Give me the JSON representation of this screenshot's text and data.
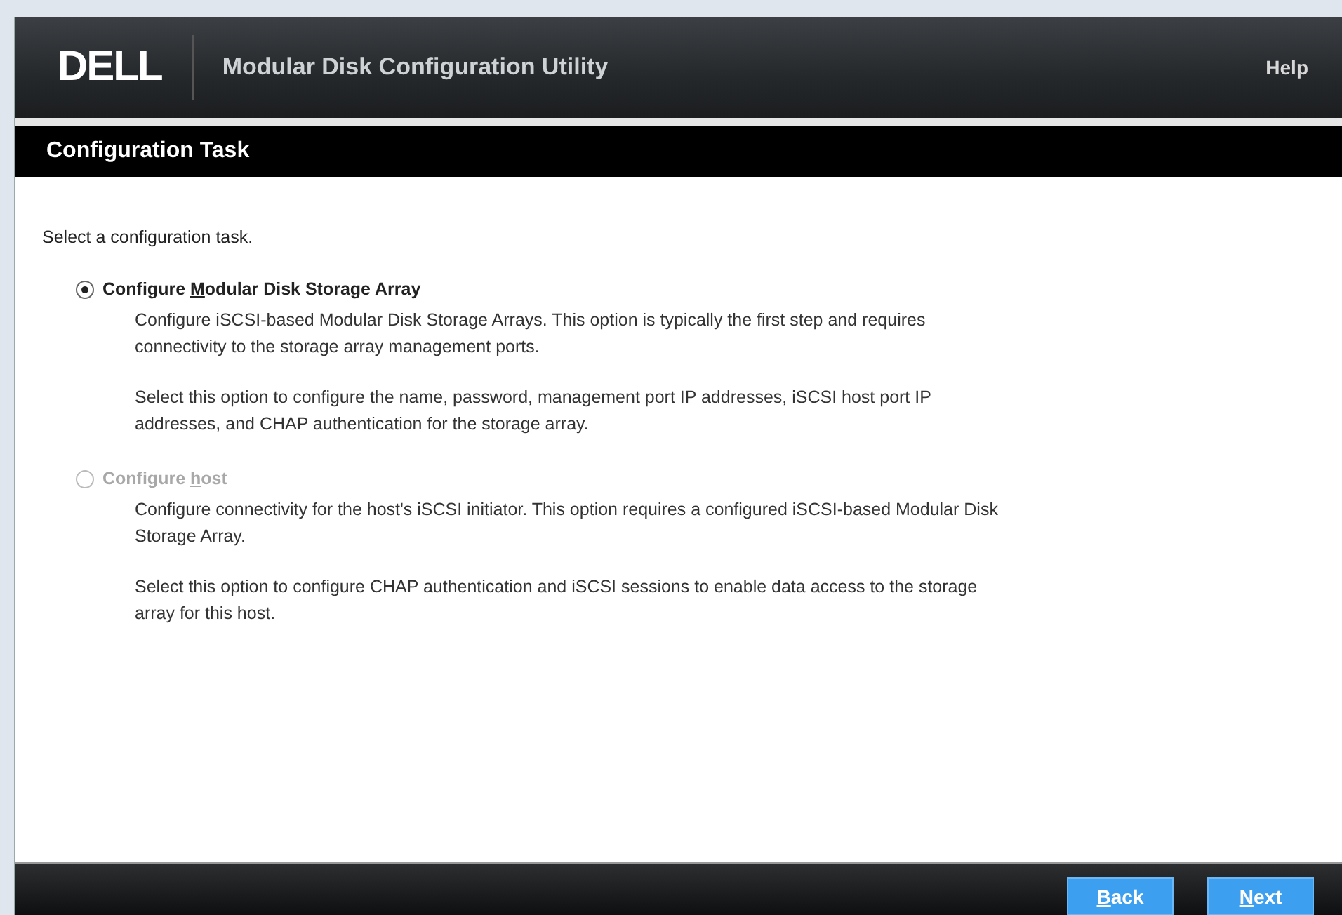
{
  "header": {
    "logo": "DELL",
    "title": "Modular Disk Configuration Utility",
    "help": "Help"
  },
  "section_title": "Configuration Task",
  "prompt": "Select a configuration task.",
  "options": [
    {
      "label_parts": [
        "Configure ",
        "M",
        "odular Disk Storage Array"
      ],
      "selected": true,
      "disabled": false,
      "paragraphs": [
        "Configure iSCSI-based Modular Disk Storage Arrays. This option is typically the first step and requires connectivity to the storage array management ports.",
        "Select this option to configure the name, password, management port IP addresses, iSCSI host port IP addresses, and CHAP authentication for the storage array."
      ]
    },
    {
      "label_parts": [
        "Configure ",
        "h",
        "ost"
      ],
      "selected": false,
      "disabled": true,
      "paragraphs": [
        "Configure connectivity for the host's iSCSI initiator. This option requires a configured iSCSI-based Modular Disk Storage Array.",
        "Select this option to configure CHAP authentication and iSCSI sessions to enable data access to the storage array for this host."
      ]
    }
  ],
  "buttons": [
    {
      "key": "B",
      "rest": "ack"
    },
    {
      "key": "N",
      "rest": "ext"
    }
  ]
}
